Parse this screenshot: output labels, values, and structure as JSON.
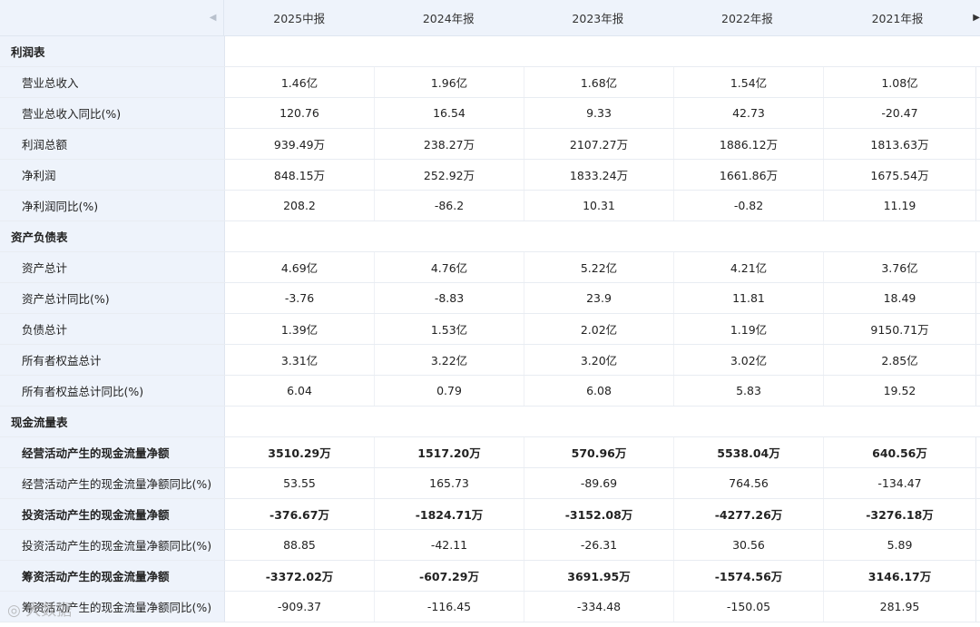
{
  "header": {
    "scroll_left_icon": "caret-left-icon",
    "scroll_right_icon": "caret-right-icon",
    "columns": [
      "2025中报",
      "2024年报",
      "2023年报",
      "2022年报",
      "2021年报"
    ]
  },
  "rows": [
    {
      "type": "section",
      "label": "利润表"
    },
    {
      "type": "data",
      "label": "营业总收入",
      "values": [
        "1.46亿",
        "1.96亿",
        "1.68亿",
        "1.54亿",
        "1.08亿"
      ]
    },
    {
      "type": "data",
      "label": "营业总收入同比(%)",
      "values": [
        "120.76",
        "16.54",
        "9.33",
        "42.73",
        "-20.47"
      ]
    },
    {
      "type": "data",
      "label": "利润总额",
      "values": [
        "939.49万",
        "238.27万",
        "2107.27万",
        "1886.12万",
        "1813.63万"
      ]
    },
    {
      "type": "data",
      "label": "净利润",
      "values": [
        "848.15万",
        "252.92万",
        "1833.24万",
        "1661.86万",
        "1675.54万"
      ]
    },
    {
      "type": "data",
      "label": "净利润同比(%)",
      "values": [
        "208.2",
        "-86.2",
        "10.31",
        "-0.82",
        "11.19"
      ]
    },
    {
      "type": "section",
      "label": "资产负债表"
    },
    {
      "type": "data",
      "label": "资产总计",
      "values": [
        "4.69亿",
        "4.76亿",
        "5.22亿",
        "4.21亿",
        "3.76亿"
      ]
    },
    {
      "type": "data",
      "label": "资产总计同比(%)",
      "values": [
        "-3.76",
        "-8.83",
        "23.9",
        "11.81",
        "18.49"
      ]
    },
    {
      "type": "data",
      "label": "负债总计",
      "values": [
        "1.39亿",
        "1.53亿",
        "2.02亿",
        "1.19亿",
        "9150.71万"
      ]
    },
    {
      "type": "data",
      "label": "所有者权益总计",
      "values": [
        "3.31亿",
        "3.22亿",
        "3.20亿",
        "3.02亿",
        "2.85亿"
      ]
    },
    {
      "type": "data",
      "label": "所有者权益总计同比(%)",
      "values": [
        "6.04",
        "0.79",
        "6.08",
        "5.83",
        "19.52"
      ]
    },
    {
      "type": "section",
      "label": "现金流量表"
    },
    {
      "type": "bold",
      "label": "经营活动产生的现金流量净额",
      "values": [
        "3510.29万",
        "1517.20万",
        "570.96万",
        "5538.04万",
        "640.56万"
      ]
    },
    {
      "type": "data",
      "label": "经营活动产生的现金流量净额同比(%)",
      "values": [
        "53.55",
        "165.73",
        "-89.69",
        "764.56",
        "-134.47"
      ]
    },
    {
      "type": "bold",
      "label": "投资活动产生的现金流量净额",
      "values": [
        "-376.67万",
        "-1824.71万",
        "-3152.08万",
        "-4277.26万",
        "-3276.18万"
      ]
    },
    {
      "type": "data",
      "label": "投资活动产生的现金流量净额同比(%)",
      "values": [
        "88.85",
        "-42.11",
        "-26.31",
        "30.56",
        "5.89"
      ]
    },
    {
      "type": "bold",
      "label": "筹资活动产生的现金流量净额",
      "values": [
        "-3372.02万",
        "-607.29万",
        "3691.95万",
        "-1574.56万",
        "3146.17万"
      ]
    },
    {
      "type": "data",
      "label": "筹资活动产生的现金流量净额同比(%)",
      "values": [
        "-909.37",
        "-116.45",
        "-334.48",
        "-150.05",
        "281.95"
      ]
    }
  ],
  "watermark": "大数据"
}
